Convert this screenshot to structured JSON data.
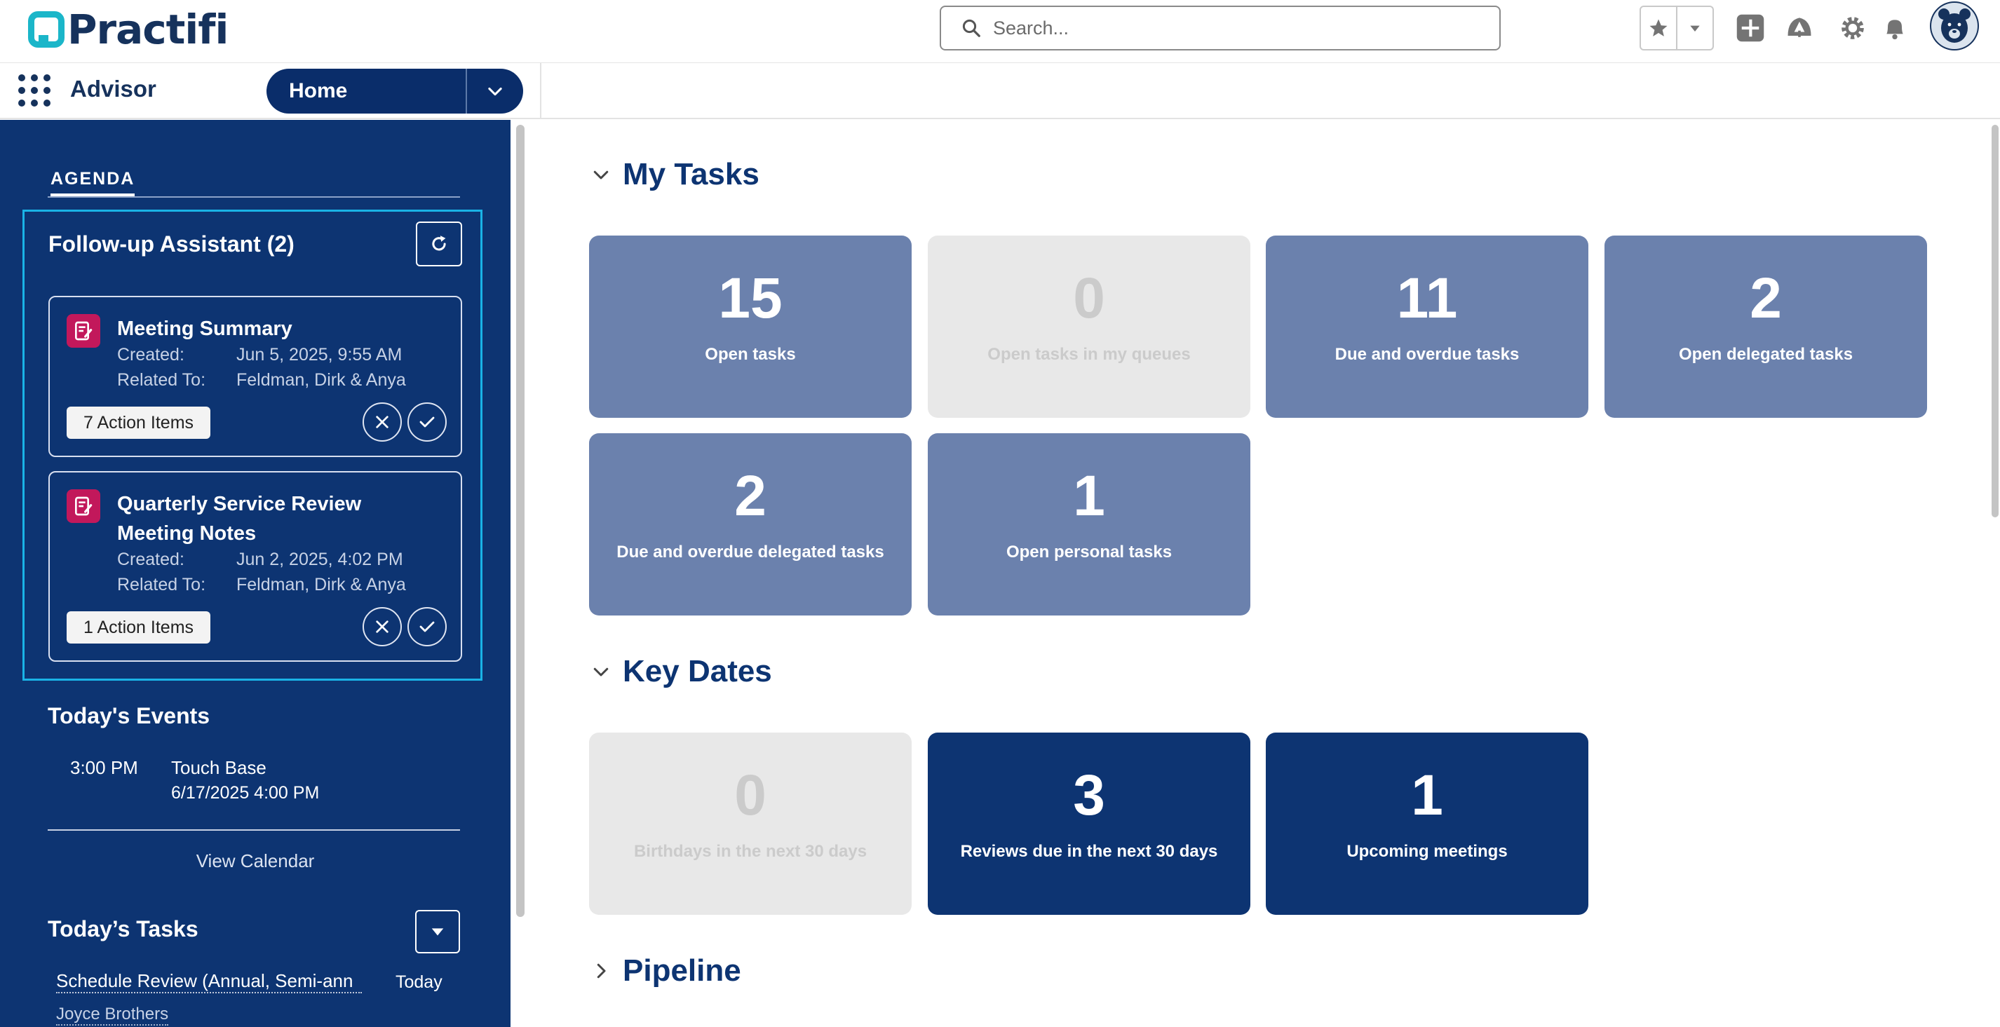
{
  "header": {
    "logo_text": "Practifi",
    "search_placeholder": "Search..."
  },
  "nav": {
    "app_name": "Advisor",
    "current_tab": "Home"
  },
  "sidebar": {
    "agenda_label": "AGENDA",
    "follow_up": {
      "title": "Follow-up Assistant (2)",
      "cards": [
        {
          "title": "Meeting Summary",
          "created_label": "Created:",
          "created_value": "Jun 5, 2025, 9:55 AM",
          "related_label": "Related To:",
          "related_value": "Feldman, Dirk & Anya",
          "action_items": "7 Action Items"
        },
        {
          "title": "Quarterly Service Review Meeting Notes",
          "created_label": "Created:",
          "created_value": "Jun 2, 2025, 4:02 PM",
          "related_label": "Related To:",
          "related_value": "Feldman, Dirk & Anya",
          "action_items": "1 Action Items"
        }
      ]
    },
    "events": {
      "title": "Today's Events",
      "items": [
        {
          "time": "3:00 PM",
          "name": "Touch Base",
          "end": "6/17/2025 4:00 PM"
        }
      ],
      "view_calendar": "View Calendar"
    },
    "tasks": {
      "title": "Today’s Tasks",
      "items": [
        {
          "name": "Schedule Review (Annual, Semi-ann",
          "date": "Today",
          "contact": "Joyce Brothers"
        }
      ]
    }
  },
  "main": {
    "my_tasks": {
      "title": "My Tasks",
      "tiles": [
        {
          "value": "15",
          "label": "Open tasks"
        },
        {
          "value": "0",
          "label": "Open tasks in my queues"
        },
        {
          "value": "11",
          "label": "Due and overdue tasks"
        },
        {
          "value": "2",
          "label": "Open delegated tasks"
        },
        {
          "value": "2",
          "label": "Due and overdue delegated tasks"
        },
        {
          "value": "1",
          "label": "Open personal tasks"
        }
      ]
    },
    "key_dates": {
      "title": "Key Dates",
      "tiles": [
        {
          "value": "0",
          "label": "Birthdays in the next 30 days"
        },
        {
          "value": "3",
          "label": "Reviews due in the next 30 days"
        },
        {
          "value": "1",
          "label": "Upcoming meetings"
        }
      ]
    },
    "pipeline": {
      "title": "Pipeline"
    }
  },
  "colors": {
    "navy": "#0d3472",
    "tile_light": "#6b81ad",
    "tile_empty": "#e8e8e8",
    "accent_cyan": "#1ab3e6",
    "icon_magenta": "#c2185b"
  }
}
